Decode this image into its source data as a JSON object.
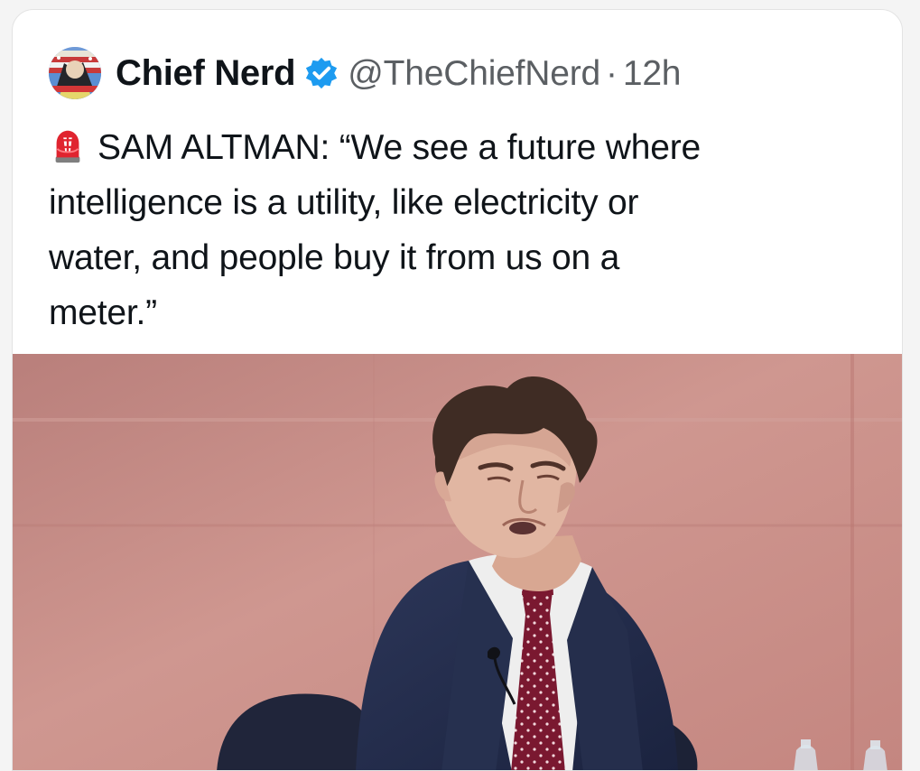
{
  "tweet": {
    "author_name": "Chief Nerd",
    "handle": "@TheChiefNerd",
    "separator": "·",
    "timestamp": "12h",
    "siren_icon": "siren-icon",
    "text_lines": [
      "SAM ALTMAN: “We see a future where",
      "intelligence is a utility, like electricity or",
      "water, and people buy it from us on a",
      "meter.”"
    ],
    "verified_icon": "verified-badge-icon",
    "avatar_icon": "avatar"
  },
  "colors": {
    "text": "#0f1419",
    "secondary_text": "#5b5f63",
    "verified_blue": "#1d9bf0",
    "siren_red": "#e0242f",
    "media_background": "#c88b84"
  }
}
